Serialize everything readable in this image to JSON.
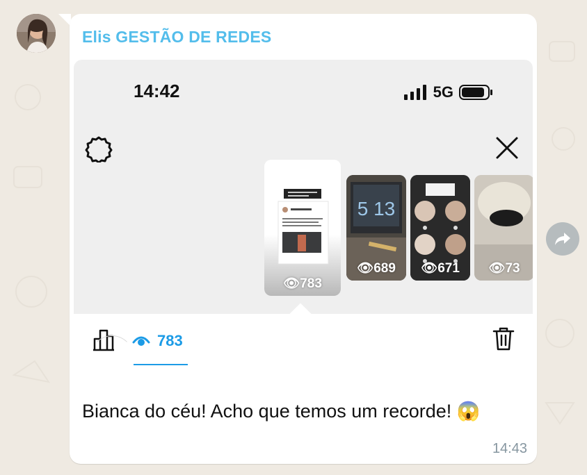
{
  "message": {
    "sender": "Elis GESTÃO DE REDES",
    "caption": "Bianca do céu! Acho que temos um recorde! 😱",
    "time": "14:43"
  },
  "screenshot": {
    "clock": "14:42",
    "network": "5G",
    "stories": [
      {
        "views": "783",
        "selected": true
      },
      {
        "views": "689",
        "clock_text": "5 13"
      },
      {
        "views": "671"
      },
      {
        "views": "73"
      }
    ],
    "viewers_count": "783"
  },
  "colors": {
    "sender": "#53bdeb",
    "accent": "#1c9be6",
    "chat_bg": "#efeae2"
  }
}
